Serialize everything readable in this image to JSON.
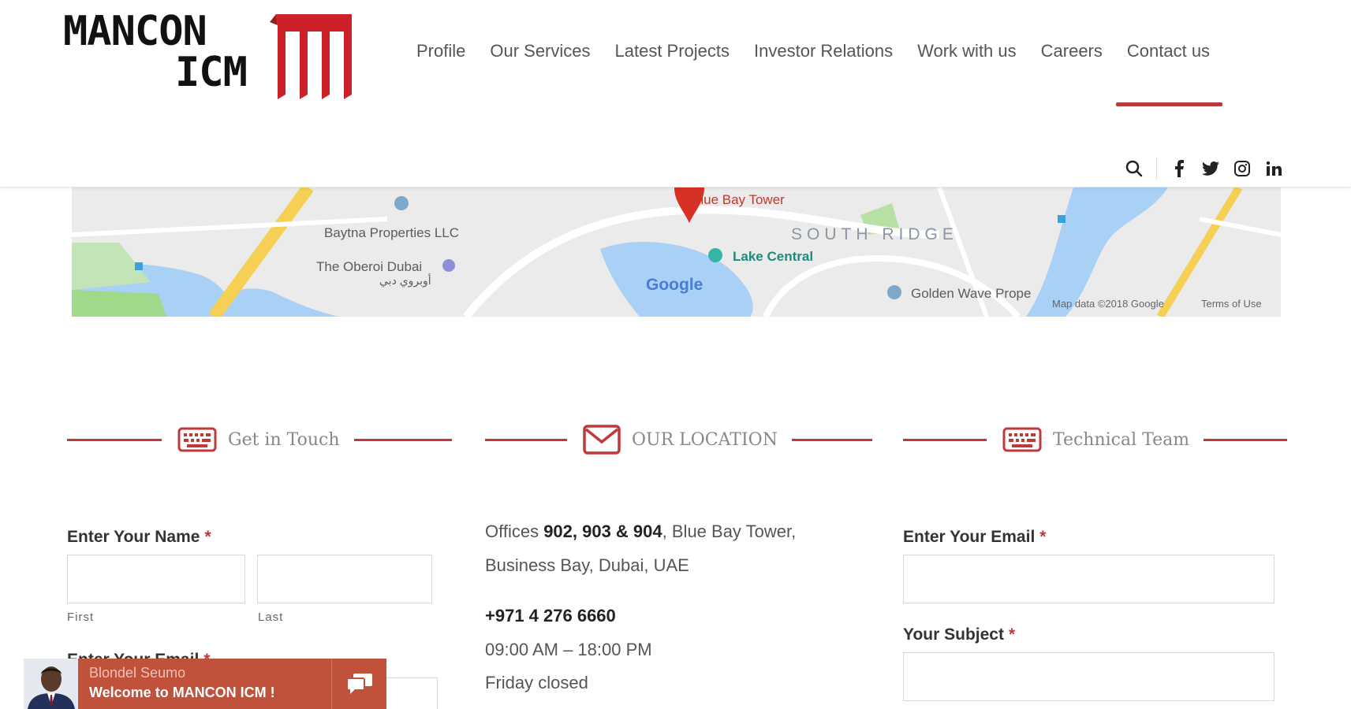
{
  "brand": {
    "line1": "MANCON",
    "line2": "ICM",
    "accent": "#cc2128"
  },
  "nav": {
    "items": [
      {
        "label": "Profile"
      },
      {
        "label": "Our Services"
      },
      {
        "label": "Latest Projects"
      },
      {
        "label": "Investor Relations"
      },
      {
        "label": "Work with us"
      },
      {
        "label": "Careers"
      },
      {
        "label": "Contact us",
        "active": true
      }
    ]
  },
  "social": [
    "search-icon",
    "facebook-icon",
    "twitter-icon",
    "instagram-icon",
    "linkedin-icon"
  ],
  "map": {
    "marker_label": "Blue Bay Tower",
    "area_label": "SOUTH RIDGE",
    "places": [
      "Baytna Properties LLC",
      "The Oberoi Dubai",
      "Lake Central",
      "Golden Wave Prope"
    ],
    "arabic_label": "أوبروي دبي",
    "google_logo": "Google",
    "attribution": "Map data ©2018 Google",
    "terms": "Terms of Use"
  },
  "sections": {
    "get_in_touch": "Get in Touch",
    "our_location": "OUR LOCATION",
    "technical_team": "Technical Team"
  },
  "form": {
    "name_label": "Enter Your Name",
    "first_sub": "First",
    "last_sub": "Last",
    "email_label_left": "Enter Your Email",
    "email_label": "Enter Your Email",
    "subject_label": "Your Subject",
    "required_mark": "*"
  },
  "location": {
    "offices_prefix": "Offices ",
    "offices_numbers": "902, 903 & 904",
    "offices_suffix": ", Blue Bay Tower,",
    "line2": "Business Bay, Dubai, UAE",
    "phone": "+971 4 276 6660",
    "hours": "09:00 AM – 18:00 PM",
    "closed": "Friday closed"
  },
  "chat": {
    "agent_name": "Blondel Seumo",
    "welcome": "Welcome to MANCON ICM !"
  },
  "colors": {
    "accent_red": "#c0393a",
    "chat_bg": "#c0513a"
  }
}
